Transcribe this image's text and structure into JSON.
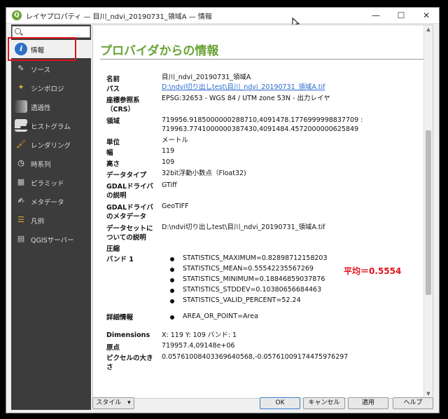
{
  "window": {
    "title": "レイヤプロパティ — 目川_ndvi_20190731_領域A — 情報",
    "app_icon": "Q",
    "minimize": "—",
    "maximize": "☐",
    "close": "✕"
  },
  "sidebar": {
    "items": [
      {
        "label": "情報",
        "icon": "info-icon"
      },
      {
        "label": "ソース",
        "icon": "source-icon"
      },
      {
        "label": "シンボロジ",
        "icon": "symbology-icon"
      },
      {
        "label": "透過性",
        "icon": "transparency-icon"
      },
      {
        "label": "ヒストグラム",
        "icon": "histogram-icon"
      },
      {
        "label": "レンダリング",
        "icon": "rendering-icon"
      },
      {
        "label": "時系列",
        "icon": "clock-icon"
      },
      {
        "label": "ピラミッド",
        "icon": "pyramid-icon"
      },
      {
        "label": "メタデータ",
        "icon": "metadata-icon"
      },
      {
        "label": "凡例",
        "icon": "legend-icon"
      },
      {
        "label": "QGISサーバー",
        "icon": "server-icon"
      }
    ]
  },
  "content": {
    "heading": "プロバイダからの情報",
    "fields": {
      "name_label": "名前",
      "name_value": "目川_ndvi_20190731_領域A",
      "path_label": "パス",
      "path_value": "D:\\ndvi切り出しtest\\目川_ndvi_20190731_領域A.tif",
      "crs_label_1": "座標参照系",
      "crs_label_2": "（CRS）",
      "crs_value": "EPSG:32653 - WGS 84 / UTM zone 53N - 出力レイヤ",
      "extent_label": "領域",
      "extent_value_1": "719956.9185000000288710,4091478.1776999998837709 :",
      "extent_value_2": "719963.7741000000387430,4091484.4572000000625849",
      "unit_label": "単位",
      "unit_value": "メートル",
      "width_label": "幅",
      "width_value": "119",
      "height_label": "高さ",
      "height_value": "109",
      "datatype_label": "データタイプ",
      "datatype_value": "32bit浮動小数点（Float32)",
      "driver_desc_label_1": "GDALドライバ",
      "driver_desc_label_2": "の説明",
      "driver_desc_value": "GTiff",
      "driver_meta_label_1": "GDALドライバ",
      "driver_meta_label_2": "のメタデータ",
      "driver_meta_value": "GeoTIFF",
      "dataset_label_1": "データセットに",
      "dataset_label_2": "ついての説明",
      "dataset_value": "D:\\ndvi切り出しtest\\目川_ndvi_20190731_領域A.tif",
      "compression_label": "圧縮",
      "band_label": "バンド 1",
      "band_stats": [
        "STATISTICS_MAXIMUM=0.82898712158203",
        "STATISTICS_MEAN=0.55542235567269",
        "STATISTICS_MINIMUM=0.18846859037876",
        "STATISTICS_STDDEV=0.10380656684463",
        "STATISTICS_VALID_PERCENT=52.24"
      ],
      "more_info_label": "詳細情報",
      "more_info_value": "AREA_OR_POINT=Area",
      "dimensions_label": "Dimensions",
      "dimensions_value": "X: 119 Y: 109 バンド: 1",
      "origin_label": "原点",
      "origin_value": "719957.4,09148e+06",
      "pixel_size_label_1": "ピクセルの大き",
      "pixel_size_label_2": "さ",
      "pixel_size_value": "0.05761008403369640568,-0.05761009174475976297"
    },
    "annotation": "平均＝0.5554"
  },
  "footer": {
    "style_label": "スタイル",
    "style_arrow": "▾",
    "ok_label": "OK",
    "cancel_label": "キャンセル",
    "apply_label": "適用",
    "help_label": "ヘルプ"
  },
  "colors": {
    "heading": "#6aa336",
    "annotation": "#e0141e",
    "sidebar_bg": "#3c3c3c",
    "link": "#2a6bd1"
  }
}
